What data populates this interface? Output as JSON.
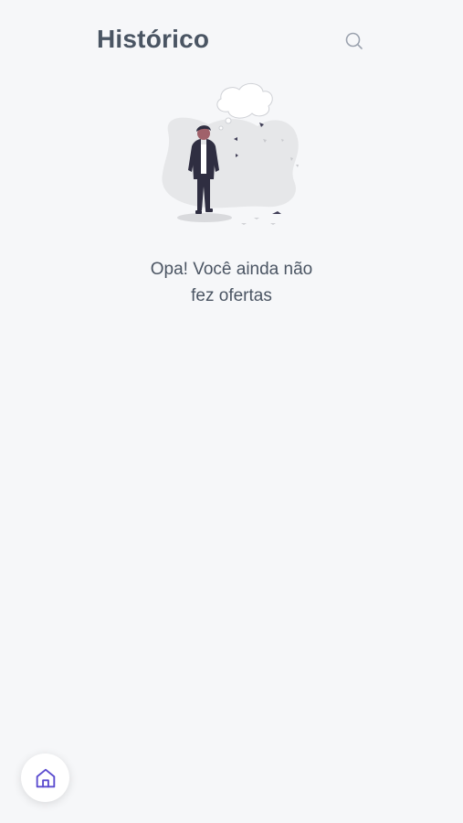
{
  "header": {
    "title": "Histórico",
    "search_icon": "search-icon"
  },
  "empty_state": {
    "illustration_icon": "person-walking-thought-cloud-illustration",
    "message_line1": "Opa! Você ainda não",
    "message_line2": "fez ofertas"
  },
  "bottom_nav": {
    "home_icon": "home-icon"
  },
  "colors": {
    "background": "#f6f7f9",
    "title": "#4a5563",
    "text": "#4b5563",
    "icon_muted": "#9ca3af",
    "accent": "#5b4ccf"
  }
}
